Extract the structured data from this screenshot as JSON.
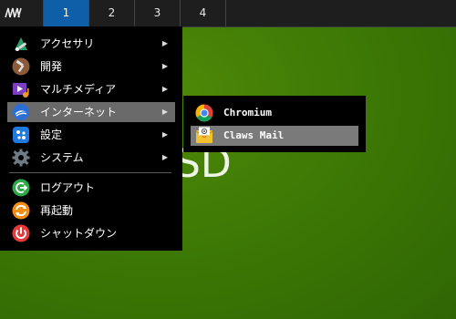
{
  "taskbar": {
    "menu_icon": "app-menu-icon",
    "workspaces": [
      "1",
      "2",
      "3",
      "4"
    ],
    "active_workspace": "1"
  },
  "desktop": {
    "text": "SD"
  },
  "menu": {
    "items": [
      {
        "label": "アクセサリ",
        "icon": "accessories-icon",
        "has_submenu": true
      },
      {
        "label": "開発",
        "icon": "development-icon",
        "has_submenu": true
      },
      {
        "label": "マルチメディア",
        "icon": "multimedia-icon",
        "has_submenu": true
      },
      {
        "label": "インターネット",
        "icon": "internet-icon",
        "has_submenu": true
      },
      {
        "label": "設定",
        "icon": "settings-icon",
        "has_submenu": true
      },
      {
        "label": "システム",
        "icon": "system-icon",
        "has_submenu": true
      },
      {
        "label": "ログアウト",
        "icon": "logout-icon",
        "has_submenu": false
      },
      {
        "label": "再起動",
        "icon": "reboot-icon",
        "has_submenu": false
      },
      {
        "label": "シャットダウン",
        "icon": "shutdown-icon",
        "has_submenu": false
      }
    ],
    "arrow": "▶"
  },
  "submenu": {
    "items": [
      {
        "label": "Chromium",
        "icon": "chromium-icon"
      },
      {
        "label": "Claws Mail",
        "icon": "claws-mail-icon"
      }
    ]
  },
  "colors": {
    "active_workspace": "#0f5fa8",
    "highlight": "#6a6a6a",
    "desktop_green": "#3e7a05"
  }
}
